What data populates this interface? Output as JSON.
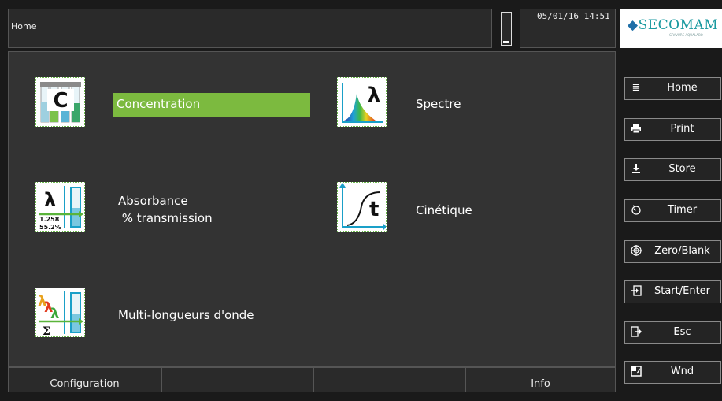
{
  "header": {
    "title": "Home",
    "datetime": "05/01/16 14:51",
    "battery_level": 0.08
  },
  "brand": {
    "logo": "SECOMAM",
    "tagline": "GRAVURE AQUALABO"
  },
  "tiles": [
    {
      "label": "Concentration",
      "icon": "concentration-icon",
      "selected": true
    },
    {
      "label": "Spectre",
      "icon": "spectrum-icon",
      "selected": false
    },
    {
      "label": "Absorbance\n % transmission",
      "icon": "absorbance-icon",
      "selected": false,
      "icon_text": {
        "lambda": "λ",
        "abs_value": "1.258",
        "trans_value": "55.2%"
      }
    },
    {
      "label": "Cinétique",
      "icon": "kinetics-icon",
      "selected": false,
      "icon_text": {
        "t": "t"
      }
    },
    {
      "label": "Multi-longueurs d'onde",
      "icon": "multi-wavelength-icon",
      "selected": false,
      "icon_text": {
        "sigma": "Σ"
      }
    }
  ],
  "concentration_icon_text": "C",
  "spectrum_icon_text": "λ",
  "footer": {
    "configuration": "Configuration",
    "info": "Info"
  },
  "side_buttons": [
    {
      "label": "Home",
      "icon": "list-icon"
    },
    {
      "label": "Print",
      "icon": "printer-icon"
    },
    {
      "label": "Store",
      "icon": "download-icon"
    },
    {
      "label": "Timer",
      "icon": "timer-icon"
    },
    {
      "label": "Zero/Blank",
      "icon": "target-icon"
    },
    {
      "label": "Start/Enter",
      "icon": "enter-icon"
    },
    {
      "label": "Esc",
      "icon": "exit-icon"
    },
    {
      "label": "Wnd",
      "icon": "window-icon"
    }
  ],
  "colors": {
    "accent_green": "#7cba3f",
    "brand_teal": "#1a9aa0",
    "background": "#333333"
  }
}
